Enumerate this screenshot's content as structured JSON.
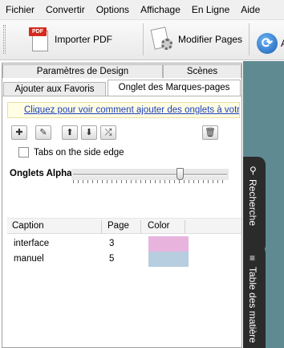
{
  "menubar": {
    "items": [
      "Fichier",
      "Convertir",
      "Options",
      "Affichage",
      "En Ligne",
      "Aide"
    ]
  },
  "toolbar": {
    "import_pdf_label": "Importer PDF",
    "modify_pages_label": "Modifier Pages",
    "pdf_badge": "PDF",
    "truncated_label": "A"
  },
  "tabs": {
    "row_back": [
      "Paramètres de Design",
      "Scènes"
    ],
    "row_front": [
      "Ajouter aux Favoris",
      "Onglet des Marques-pages"
    ],
    "active": "Onglet des Marques-pages"
  },
  "bookmarks_panel": {
    "help_link": "Cliquez pour voir comment ajouter des onglets à votre fl",
    "tabs_on_side_edge_label": "Tabs on the side edge",
    "tabs_on_side_edge_checked": false,
    "alpha_label": "Onglets Alpha:",
    "alpha_value": 0.7,
    "columns": [
      "Caption",
      "Page",
      "Color"
    ],
    "rows": [
      {
        "caption": "interface",
        "page": "3",
        "color": "#e8b4de"
      },
      {
        "caption": "manuel",
        "page": "5",
        "color": "#b7cde0"
      }
    ]
  },
  "side_tabs": {
    "search_label": "Recherche",
    "toc_label": "Table des matière"
  },
  "colors": {
    "side_area": "#5f8a92",
    "side_tab": "#2b2b2b",
    "link": "#1a3fbf"
  },
  "icons": {
    "add": "add-icon",
    "edit": "edit-icon",
    "up": "arrow-up-icon",
    "down": "arrow-down-icon",
    "shuffle": "shuffle-icon",
    "delete": "trash-icon",
    "search": "search-icon",
    "toc": "list-icon"
  }
}
